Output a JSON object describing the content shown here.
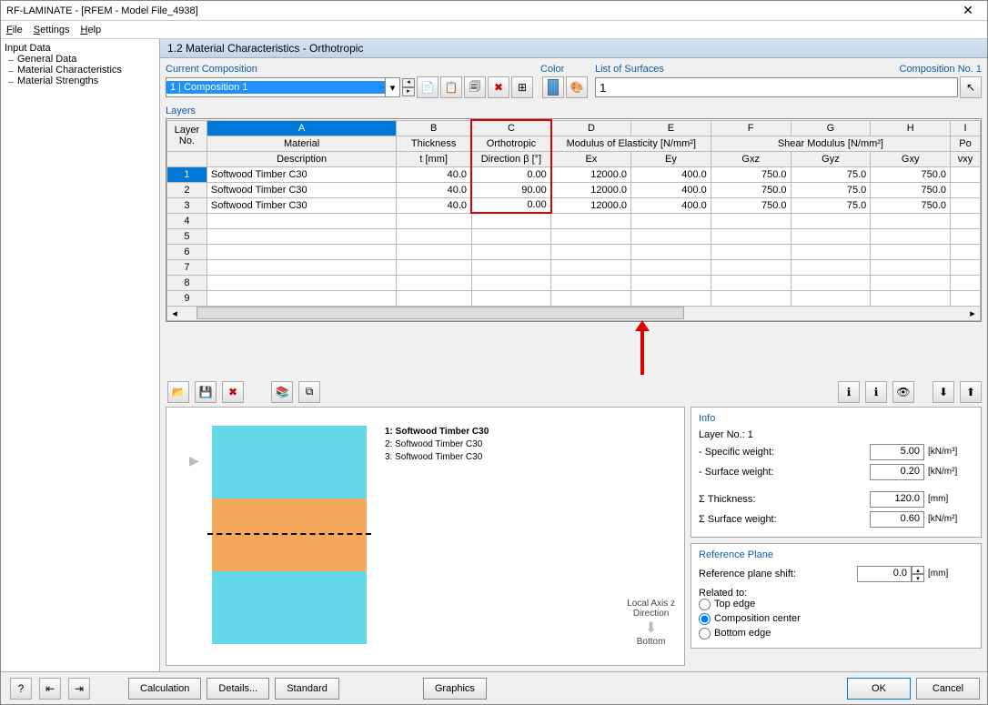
{
  "title": "RF-LAMINATE - [RFEM - Model File_4938]",
  "menu": {
    "file": "File",
    "settings": "Settings",
    "help": "Help"
  },
  "tree": {
    "root": "Input Data",
    "items": [
      "General Data",
      "Material Characteristics",
      "Material Strengths"
    ]
  },
  "header": "1.2 Material Characteristics - Orthotropic",
  "composition": {
    "label": "Current Composition",
    "selected": "1 | Composition 1"
  },
  "color": {
    "label": "Color"
  },
  "surfaces": {
    "label": "List of Surfaces",
    "value": "1",
    "comp_no": "Composition No. 1"
  },
  "layers_label": "Layers",
  "table": {
    "col_letters": [
      "A",
      "B",
      "C",
      "D",
      "E",
      "F",
      "G",
      "H",
      "I"
    ],
    "row_header": {
      "layer": "Layer",
      "no": "No."
    },
    "headers": {
      "material": "Material",
      "description": "Description",
      "thickness": "Thickness",
      "t_mm": "t [mm]",
      "ortho": "Orthotropic",
      "direction": "Direction β [°]",
      "modulus": "Modulus of Elasticity [N/mm²]",
      "ex": "Ex",
      "ey": "Ey",
      "shear": "Shear Modulus [N/mm²]",
      "gxz": "Gxz",
      "gyz": "Gyz",
      "gxy": "Gxy",
      "po": "Po",
      "vxy": "νxy"
    },
    "rows": [
      {
        "no": "1",
        "desc": "Softwood Timber C30",
        "t": "40.0",
        "beta": "0.00",
        "ex": "12000.0",
        "ey": "400.0",
        "gxz": "750.0",
        "gyz": "75.0",
        "gxy": "750.0"
      },
      {
        "no": "2",
        "desc": "Softwood Timber C30",
        "t": "40.0",
        "beta": "90.00",
        "ex": "12000.0",
        "ey": "400.0",
        "gxz": "750.0",
        "gyz": "75.0",
        "gxy": "750.0"
      },
      {
        "no": "3",
        "desc": "Softwood Timber C30",
        "t": "40.0",
        "beta": "0.00",
        "ex": "12000.0",
        "ey": "400.0",
        "gxz": "750.0",
        "gyz": "75.0",
        "gxy": "750.0"
      }
    ],
    "empty_rows": [
      "4",
      "5",
      "6",
      "7",
      "8",
      "9"
    ]
  },
  "preview": {
    "labels": [
      "1: Softwood Timber C30",
      "2: Softwood Timber C30",
      "3: Softwood Timber C30"
    ],
    "axis": "Local Axis z\nDirection",
    "bottom": "Bottom"
  },
  "info": {
    "title": "Info",
    "layer_no_label": "Layer No.: 1",
    "specific_weight_label": "- Specific weight:",
    "specific_weight": "5.00",
    "specific_weight_unit": "[kN/m³]",
    "surface_weight_label": "- Surface weight:",
    "surface_weight": "0.20",
    "surface_weight_unit": "[kN/m²]",
    "thickness_label": "Σ Thickness:",
    "thickness": "120.0",
    "thickness_unit": "[mm]",
    "total_weight_label": "Σ Surface weight:",
    "total_weight": "0.60",
    "total_weight_unit": "[kN/m²]"
  },
  "ref_plane": {
    "title": "Reference Plane",
    "shift_label": "Reference plane shift:",
    "shift": "0.0",
    "shift_unit": "[mm]",
    "related_label": "Related to:",
    "top": "Top edge",
    "center": "Composition center",
    "bottom": "Bottom edge"
  },
  "buttons": {
    "calculation": "Calculation",
    "details": "Details...",
    "standard": "Standard",
    "graphics": "Graphics",
    "ok": "OK",
    "cancel": "Cancel"
  }
}
